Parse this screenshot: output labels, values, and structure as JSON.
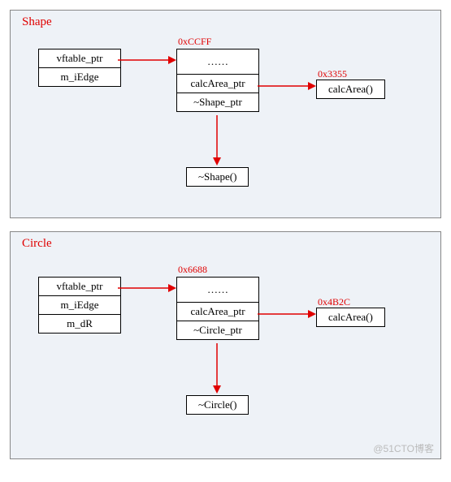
{
  "shape": {
    "title": "Shape",
    "object": [
      "vftable_ptr",
      "m_iEdge"
    ],
    "vtable_addr": "0xCCFF",
    "vtable": [
      "……",
      "calcArea_ptr",
      "~Shape_ptr"
    ],
    "fn1_addr": "0x3355",
    "fn1": "calcArea()",
    "fn2": "~Shape()"
  },
  "circle": {
    "title": "Circle",
    "object": [
      "vftable_ptr",
      "m_iEdge",
      "m_dR"
    ],
    "vtable_addr": "0x6688",
    "vtable": [
      "……",
      "calcArea_ptr",
      "~Circle_ptr"
    ],
    "fn1_addr": "0x4B2C",
    "fn1": "calcArea()",
    "fn2": "~Circle()"
  },
  "watermark": "@51CTO博客"
}
